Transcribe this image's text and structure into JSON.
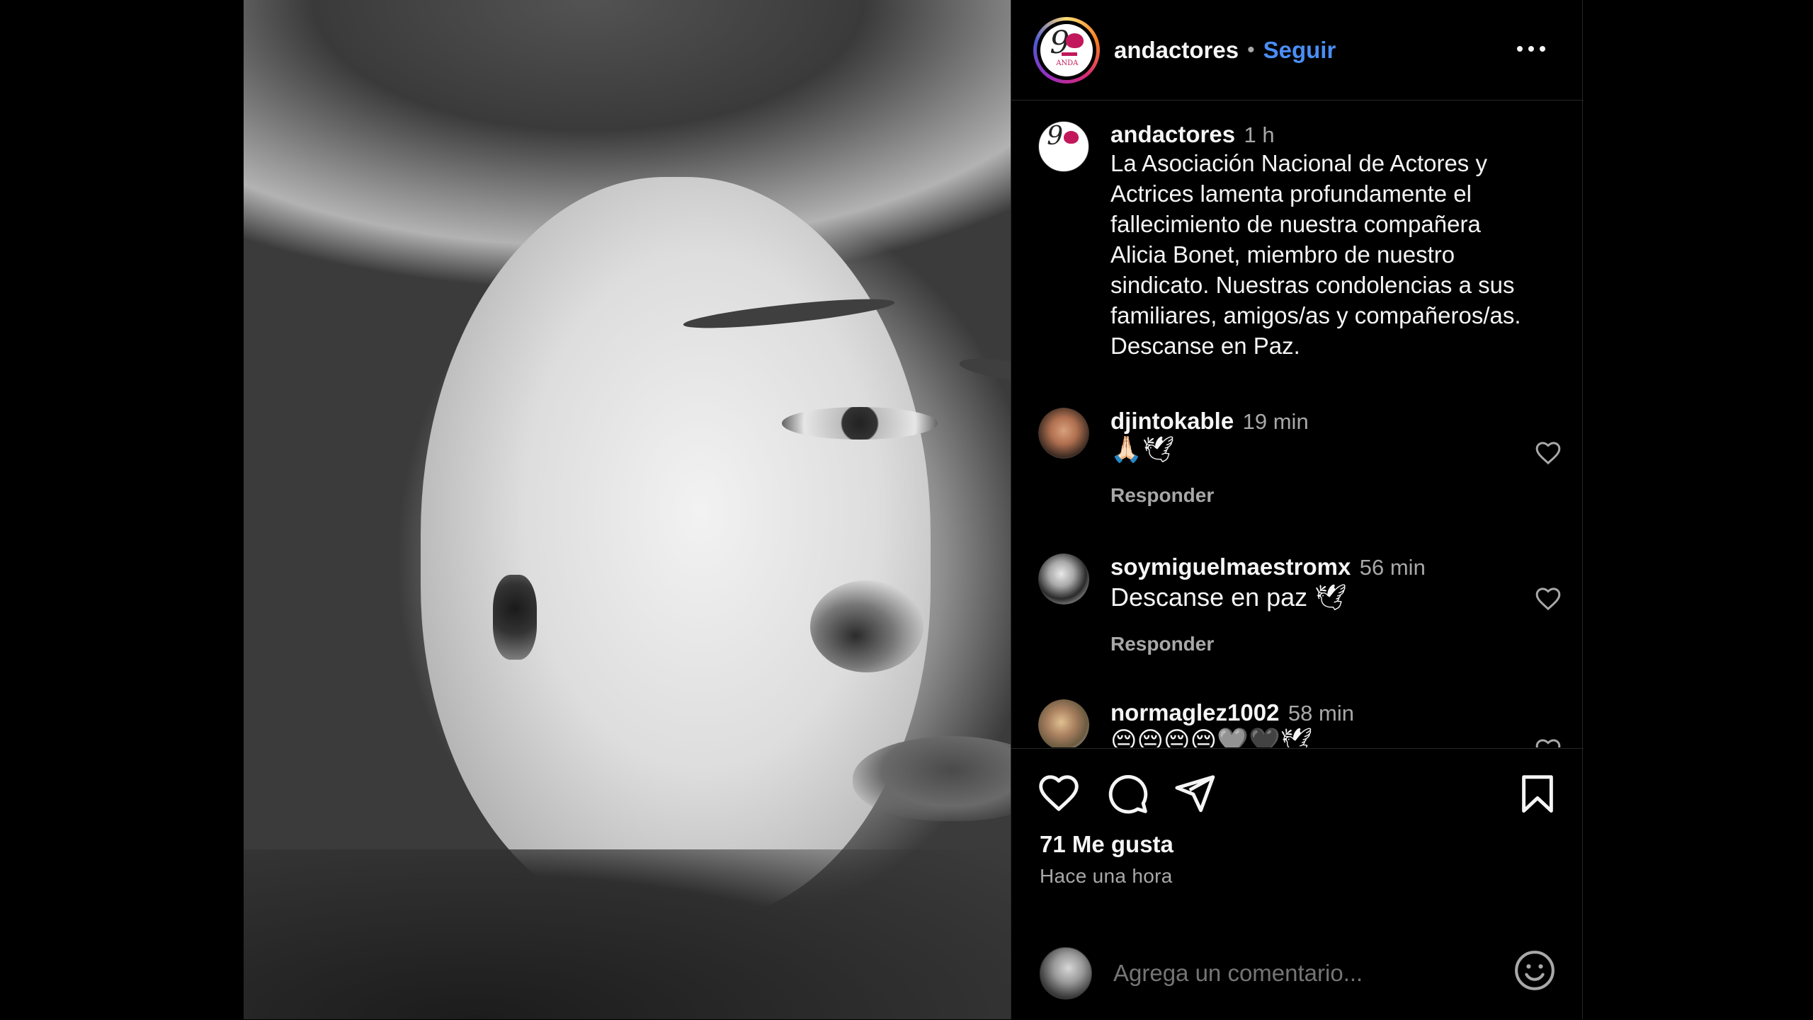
{
  "post": {
    "username": "andactores",
    "dot": "•",
    "follow_label": "Seguir",
    "logo_text": "ANDA"
  },
  "caption": {
    "username": "andactores",
    "time": "1 h",
    "text": "La Asociación Nacional de Actores y Actrices lamenta profundamente el fallecimiento de nuestra compañera Alicia Bonet, miembro de nuestro sindicato. Nuestras condolencias a sus familiares, amigos/as y compañeros/as. Descanse en Paz."
  },
  "comments": [
    {
      "username": "djintokable",
      "time": "19 min",
      "text": "🙏🏻🕊",
      "reply_label": "Responder"
    },
    {
      "username": "soymiguelmaestromx",
      "time": "56 min",
      "text": "Descanse en paz 🕊",
      "reply_label": "Responder"
    },
    {
      "username": "normaglez1002",
      "time": "58 min",
      "text": "😔😔😔😔🩶🖤🕊"
    }
  ],
  "actions": {
    "icons": [
      "heart-icon",
      "comment-icon",
      "share-icon",
      "bookmark-icon"
    ],
    "likes": "71 Me gusta",
    "posted": "Hace una hora"
  },
  "add_comment": {
    "placeholder": "Agrega un comentario..."
  },
  "colors": {
    "background": "#000000",
    "link": "#4a8ef5",
    "muted": "#a8a8a8",
    "brand": "#c2185b"
  }
}
